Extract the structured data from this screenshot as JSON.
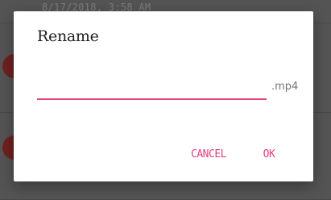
{
  "background": {
    "top_timestamp": "8/17/2018, 3:58 AM"
  },
  "dialog": {
    "title": "Rename",
    "input_value": "",
    "extension": ".mp4",
    "cancel_label": "CANCEL",
    "ok_label": "OK"
  },
  "colors": {
    "accent": "#e2407e",
    "dialog_bg": "#ffffff",
    "scrim": "#4a4a4a"
  }
}
